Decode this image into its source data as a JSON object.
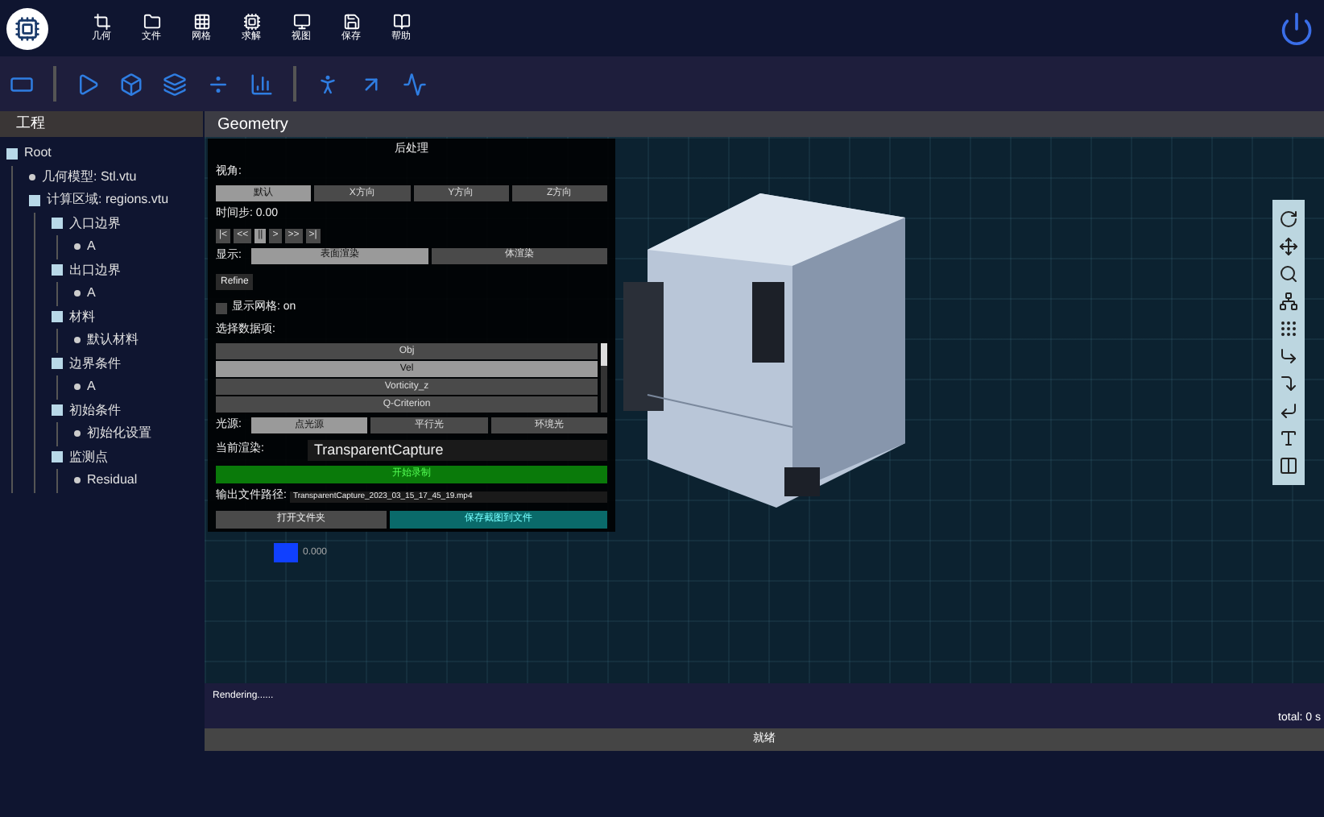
{
  "menu": [
    "几何",
    "文件",
    "网格",
    "求解",
    "视图",
    "保存",
    "帮助"
  ],
  "sidebar": {
    "title": "工程",
    "tree": [
      {
        "label": "Root",
        "children": [
          {
            "label": "几何模型: Stl.vtu"
          },
          {
            "label": "计算区域: regions.vtu",
            "children": [
              {
                "label": "入口边界",
                "children": [
                  {
                    "label": "A"
                  }
                ]
              },
              {
                "label": "出口边界",
                "children": [
                  {
                    "label": "A"
                  }
                ]
              },
              {
                "label": "材料",
                "children": [
                  {
                    "label": "默认材料"
                  }
                ]
              },
              {
                "label": "边界条件",
                "children": [
                  {
                    "label": "A"
                  }
                ]
              },
              {
                "label": "初始条件",
                "children": [
                  {
                    "label": "初始化设置"
                  }
                ]
              },
              {
                "label": "监测点",
                "children": [
                  {
                    "label": "Residual"
                  }
                ]
              }
            ]
          }
        ]
      }
    ]
  },
  "viewport": {
    "title": "Geometry"
  },
  "panel": {
    "title": "后处理",
    "view_label": "视角:",
    "views": [
      {
        "label": "默认",
        "selected": true
      },
      {
        "label": "X方向",
        "selected": false
      },
      {
        "label": "Y方向",
        "selected": false
      },
      {
        "label": "Z方向",
        "selected": false
      }
    ],
    "time_label": "时间步: 0.00",
    "steps": [
      {
        "label": "|<",
        "selected": false
      },
      {
        "label": "<<",
        "selected": false
      },
      {
        "label": "||",
        "selected": true
      },
      {
        "label": ">",
        "selected": false
      },
      {
        "label": ">>",
        "selected": false
      },
      {
        "label": ">|",
        "selected": false
      }
    ],
    "display_label": "显示:",
    "displays": [
      {
        "label": "表面渲染",
        "selected": true
      },
      {
        "label": "体渲染",
        "selected": false
      }
    ],
    "refine": "Refine",
    "mesh_check": {
      "label": "显示网格: on",
      "checked": false
    },
    "fields_label": "选择数据项:",
    "fields": [
      {
        "label": "Obj",
        "selected": false
      },
      {
        "label": "Vel",
        "selected": true
      },
      {
        "label": "Vorticity_z",
        "selected": false
      },
      {
        "label": "Q-Criterion",
        "selected": false
      }
    ],
    "light_label": "光源:",
    "lights": [
      {
        "label": "点光源",
        "selected": true
      },
      {
        "label": "平行光",
        "selected": false
      },
      {
        "label": "环境光",
        "selected": false
      }
    ],
    "render_label": "当前渲染:",
    "render_value": "TransparentCapture",
    "record": "开始录制",
    "output_label": "输出文件路径:",
    "output_value": "TransparentCapture_2023_03_15_17_45_19.mp4",
    "buttons": [
      "打开文件夹",
      "保存截图到文件"
    ]
  },
  "legend": {
    "value": "0.000"
  },
  "log": {
    "text": "Rendering......",
    "total": "total: 0 s"
  },
  "status": "就绪"
}
